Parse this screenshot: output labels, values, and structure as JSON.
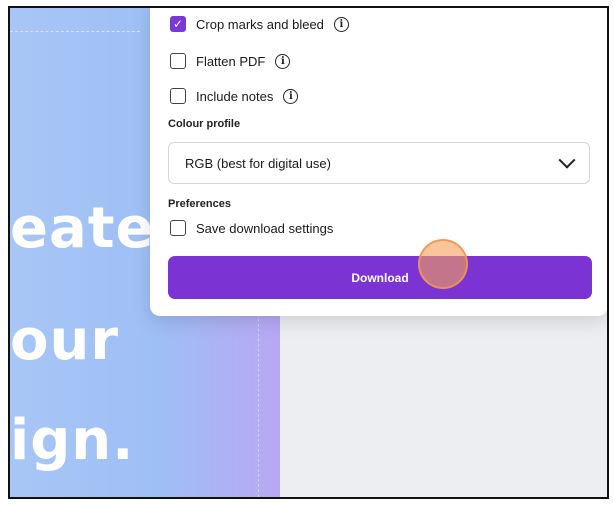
{
  "design_preview": {
    "text_lines": [
      "eate",
      "our",
      "ign."
    ]
  },
  "panel": {
    "checkboxes": [
      {
        "label": "Crop marks and bleed",
        "checked": true,
        "has_info": true
      },
      {
        "label": "Flatten PDF",
        "checked": false,
        "has_info": true
      },
      {
        "label": "Include notes",
        "checked": false,
        "has_info": true
      }
    ],
    "colour_profile": {
      "label": "Colour profile",
      "selected": "RGB (best for digital use)"
    },
    "preferences": {
      "label": "Preferences",
      "save_settings_label": "Save download settings",
      "save_settings_checked": false
    },
    "download_button": "Download"
  },
  "colors": {
    "accent": "#7c33d4",
    "cursor_highlight": "#f5a05a"
  }
}
